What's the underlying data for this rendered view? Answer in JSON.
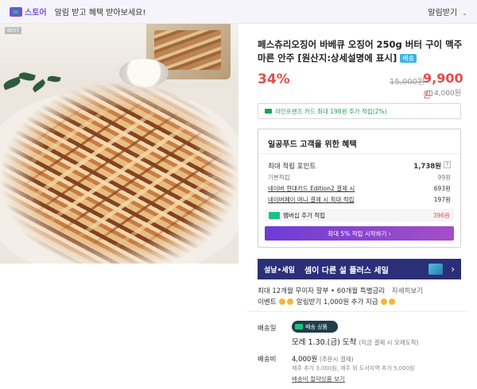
{
  "topbar": {
    "store_label": "스토어",
    "message": "알림 받고 혜택 받아보세요!",
    "action": "알림받기",
    "action_icon": "chevron-down-icon"
  },
  "image": {
    "badge": "BEST"
  },
  "product": {
    "title": "페스츄리오징어 바베큐 오징어 250g 버터 구이 맥주 마른 안주 [원산지:상세설명에 표시]",
    "delivery_tag": "배송",
    "discount": "34%",
    "original_price": "15,000원",
    "sale_price": "9,900",
    "sale_price_unit": "원",
    "unit_price": "4,000원"
  },
  "card_promo": "라인프렌즈 카드 최대 198원 추가 적립(2%)",
  "benefits": {
    "title": "일공푸드 고객을 위한 혜택",
    "max_points_label": "최대 적립 포인트",
    "max_points_value": "1,738원",
    "help_mark": "?",
    "rows": [
      {
        "label": "기본적립",
        "value": "99원"
      },
      {
        "label": "네이버 현대카드 Edition2 결제 시",
        "value": "693원"
      },
      {
        "label": "네이버페이 머니 결제 시 최대 적립",
        "value": "197원"
      }
    ],
    "member_label": "멤버십 추가 적립",
    "member_value": "396원",
    "cta": "최대 5% 적립 시작하기 ›"
  },
  "sale_banner": {
    "tag": "설날•세일",
    "text": "셈이 다른 설 플러스 세일",
    "arrow": "›"
  },
  "installment": {
    "text": "최대 12개월 무이자 할부 • 60개월 특별금리",
    "more": "자세히보기"
  },
  "event": {
    "label": "이벤트",
    "text": "알림받기 1,000원 추가 지급"
  },
  "shipping": {
    "label": "배송일",
    "badge": "배송 상품",
    "arrival": "모레 1.30.(금) 도착",
    "arrival_note": "(지금 결제 시 오래도착)",
    "fee_label": "배송비",
    "fee": "4,000원",
    "fee_note_small": "(주문시 결제)",
    "fee_note": "제주 추가 3,000원, 제주 외 도서지역 추가 5,000원",
    "bundle": "배송비 절약상품 보기"
  },
  "colors": {
    "accent_red": "#e84b4b",
    "brand_purple": "#6f55d6",
    "naver_green": "#19c37d",
    "banner_navy": "#2b2f78"
  }
}
